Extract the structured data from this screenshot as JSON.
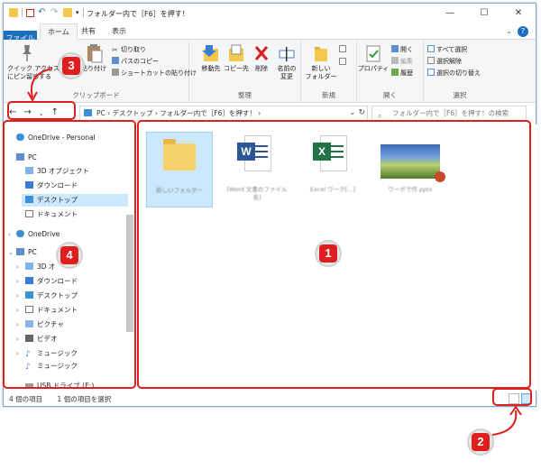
{
  "title_bar": {
    "title": "フォルダー内で［F6］を押す！",
    "minimize": "—",
    "maximize": "☐",
    "close": "✕"
  },
  "tabs": [
    "ファイル",
    "ホーム",
    "共有",
    "表示"
  ],
  "ribbon": {
    "clipboard": {
      "label": "クリップボード",
      "quick_access": "クイック アクセス\nにピン留めする",
      "paste": "貼り付け",
      "cut": "切り取り",
      "copy_path": "パスのコピー",
      "paste_shortcut": "ショートカットの貼り付け"
    },
    "organize": {
      "label": "整理",
      "move_to": "移動先",
      "copy_to": "コピー先",
      "delete": "削除",
      "rename": "名前の\n変更"
    },
    "new": {
      "label": "新規",
      "new_folder": "新しい\nフォルダー"
    },
    "open": {
      "label": "開く",
      "properties": "プロパティ",
      "open": "開く",
      "edit": "編集",
      "history": "履歴"
    },
    "select": {
      "label": "選択",
      "select_all": "すべて選択",
      "select_none": "選択解除",
      "invert": "選択の切り替え"
    }
  },
  "address": {
    "path": "PC  ›  デスクトップ  ›  フォルダー内で［F6］を押す！  ›",
    "search_placeholder": "フォルダー内で［F6］を押す！の検索"
  },
  "nav_pane": {
    "items": [
      {
        "label": "OneDrive - Personal",
        "icon": "cloud-icon"
      },
      {
        "label": "PC",
        "icon": "pc-icon"
      },
      {
        "label": "3D オブジェクト",
        "icon": "cube-icon"
      },
      {
        "label": "ダウンロード",
        "icon": "download-icon"
      },
      {
        "label": "デスクトップ",
        "icon": "desktop-icon"
      },
      {
        "label": "ドキュメント",
        "icon": "document-icon"
      },
      {
        "label": "OneDrive",
        "icon": "cloud-icon"
      },
      {
        "label": "PC",
        "icon": "pc-icon"
      },
      {
        "label": "3D オ",
        "icon": "cube-icon"
      },
      {
        "label": "ダウンロード",
        "icon": "download-icon"
      },
      {
        "label": "デスクトップ",
        "icon": "desktop-icon"
      },
      {
        "label": "ドキュメント",
        "icon": "document-icon"
      },
      {
        "label": "ピクチャ",
        "icon": "picture-icon"
      },
      {
        "label": "ビデオ",
        "icon": "video-icon"
      },
      {
        "label": "ミュージック",
        "icon": "music-icon"
      },
      {
        "label": "ミュージック",
        "icon": "music-icon"
      },
      {
        "label": "USB ドライブ (E:)",
        "icon": "usb-drive-icon"
      }
    ]
  },
  "files": [
    {
      "name": "新しいフォルダー",
      "type": "folder"
    },
    {
      "name": "[Word 文書のファイル名]",
      "type": "word"
    },
    {
      "name": "Excel ワーク[...]",
      "type": "excel"
    },
    {
      "name": "ワーポで作.pptx",
      "type": "powerpoint"
    }
  ],
  "status": {
    "items_count": "4 個の項目",
    "selected": "1 個の項目を選択"
  },
  "annotations": {
    "n1": "1",
    "n2": "2",
    "n3": "3",
    "n4": "4"
  },
  "colors": {
    "accent": "#1f6fbf",
    "highlight": "#e01e1e",
    "selection": "#cce8ff"
  }
}
